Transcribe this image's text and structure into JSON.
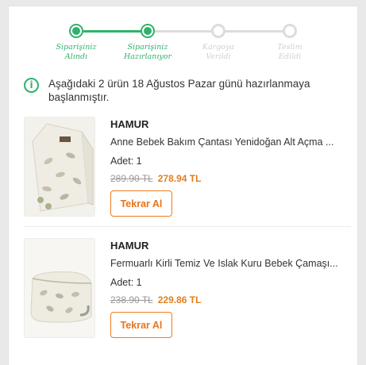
{
  "order_steps": [
    {
      "label_line1": "Siparişiniz",
      "label_line2": "Alındı",
      "status": "done"
    },
    {
      "label_line1": "Siparişiniz",
      "label_line2": "Hazırlanıyor",
      "status": "done"
    },
    {
      "label_line1": "Kargoya",
      "label_line2": "Verildi",
      "status": "todo"
    },
    {
      "label_line1": "Teslim",
      "label_line2": "Edildi",
      "status": "todo"
    }
  ],
  "info": {
    "icon": "info-icon",
    "text": "Aşağıdaki 2 ürün 18 Ağustos Pazar günü hazırlanmaya başlanmıştır."
  },
  "items": [
    {
      "brand": "HAMUR",
      "name": "Anne Bebek Bakım Çantası Yenidoğan Alt Açma ...",
      "qty": "Adet: 1",
      "old_price": "289.90 TL",
      "new_price": "278.94 TL",
      "button": "Tekrar Al"
    },
    {
      "brand": "HAMUR",
      "name": "Fermuarlı Kirli Temiz Ve Islak Kuru Bebek Çamaşı...",
      "qty": "Adet: 1",
      "old_price": "238.90 TL",
      "new_price": "229.86 TL",
      "button": "Tekrar Al"
    }
  ],
  "colors": {
    "accent_green": "#2fb36a",
    "accent_orange": "#f27a1a",
    "price_orange": "#e27f1f"
  }
}
